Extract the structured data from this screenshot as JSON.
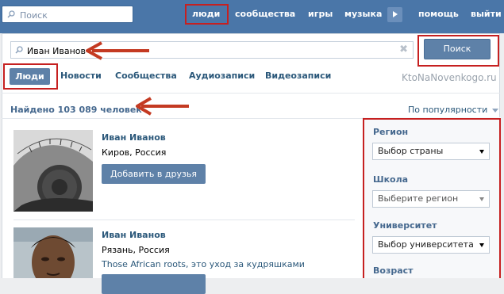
{
  "topbar": {
    "search_placeholder": "Поиск",
    "nav": [
      "люди",
      "сообщества",
      "игры",
      "музыка",
      "помощь",
      "выйти"
    ]
  },
  "search": {
    "query": "Иван Иванов",
    "button_label": "Поиск"
  },
  "tabs": [
    "Люди",
    "Новости",
    "Сообщества",
    "Аудиозаписи",
    "Видеозаписи"
  ],
  "watermark": "KtoNaNovenkogo.ru",
  "results": {
    "count_text": "Найдено 103 089 человек",
    "sort_label": "По популярности"
  },
  "people": [
    {
      "name": "Иван Иванов",
      "city": "Киров, Россия",
      "status": "",
      "add_label": "Добавить в друзья"
    },
    {
      "name": "Иван Иванов",
      "city": "Рязань, Россия",
      "status": "Those African roots, это уход за кудряшками",
      "add_label": ""
    }
  ],
  "filters": {
    "region_label": "Регион",
    "region_value": "Выбор страны",
    "school_label": "Школа",
    "school_value": "Выберите регион",
    "university_label": "Университет",
    "university_value": "Выбор университета",
    "age_label": "Возраст"
  },
  "colors": {
    "header": "#4a76a8",
    "button": "#5e81a8",
    "link": "#2b587a",
    "annotation": "#c62020"
  }
}
